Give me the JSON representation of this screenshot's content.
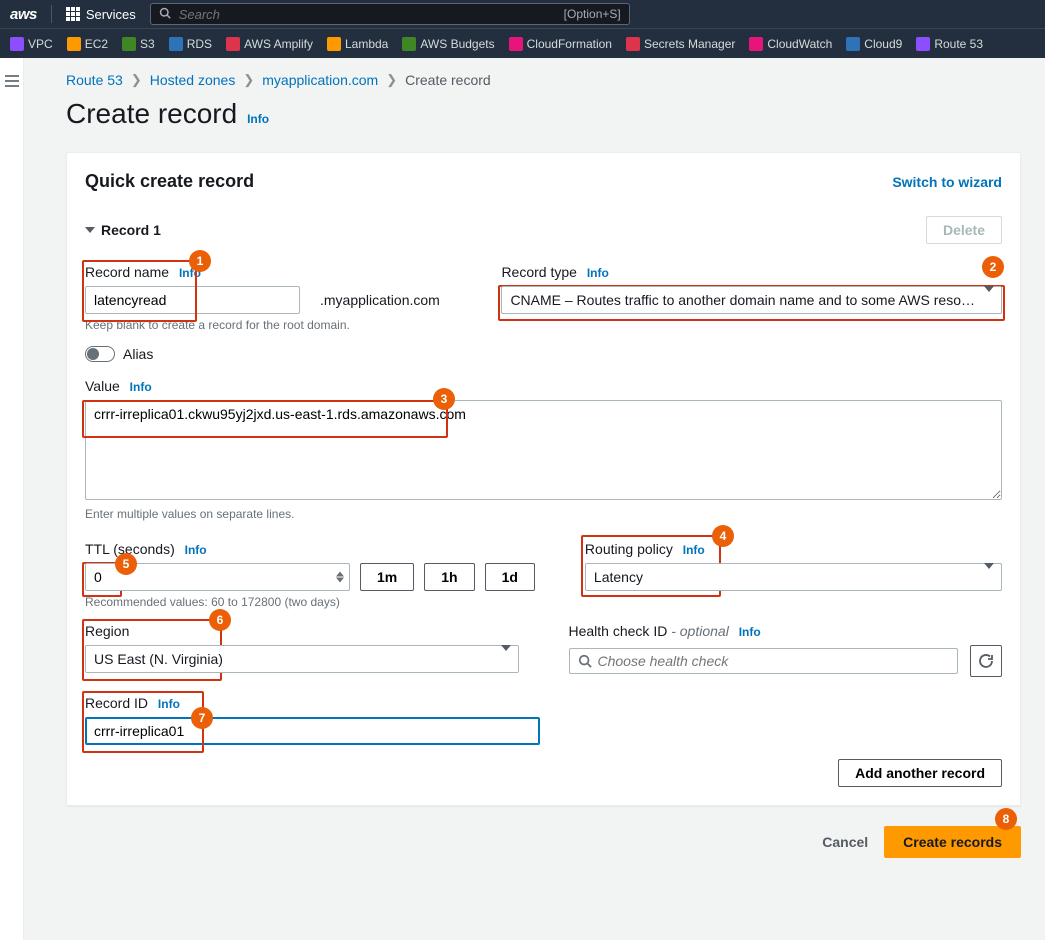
{
  "top": {
    "logo": "aws",
    "services": "Services",
    "search_placeholder": "Search",
    "shortcut": "[Option+S]"
  },
  "svcnav": [
    {
      "label": "VPC",
      "color": "#8c4fff"
    },
    {
      "label": "EC2",
      "color": "#ff9900"
    },
    {
      "label": "S3",
      "color": "#3f8624"
    },
    {
      "label": "RDS",
      "color": "#2e73b8"
    },
    {
      "label": "AWS Amplify",
      "color": "#dd344c"
    },
    {
      "label": "Lambda",
      "color": "#ff9900"
    },
    {
      "label": "AWS Budgets",
      "color": "#3f8624"
    },
    {
      "label": "CloudFormation",
      "color": "#e7157b"
    },
    {
      "label": "Secrets Manager",
      "color": "#dd344c"
    },
    {
      "label": "CloudWatch",
      "color": "#e7157b"
    },
    {
      "label": "Cloud9",
      "color": "#2e73b8"
    },
    {
      "label": "Route 53",
      "color": "#8c4fff"
    }
  ],
  "breadcrumb": {
    "r53": "Route 53",
    "hz": "Hosted zones",
    "domain": "myapplication.com",
    "current": "Create record"
  },
  "page": {
    "title": "Create record",
    "info": "Info"
  },
  "panel": {
    "title": "Quick create record",
    "switch": "Switch to wizard",
    "record_title": "Record 1",
    "delete": "Delete"
  },
  "form": {
    "record_name_label": "Record name",
    "record_name_value": "latencyread",
    "suffix": ".myapplication.com",
    "record_name_hint": "Keep blank to create a record for the root domain.",
    "record_type_label": "Record type",
    "record_type_value": "CNAME – Routes traffic to another domain name and to some AWS reso…",
    "alias_label": "Alias",
    "value_label": "Value",
    "value_text": "crrr-irreplica01.ckwu95yj2jxd.us-east-1.rds.amazonaws.com",
    "value_hint": "Enter multiple values on separate lines.",
    "ttl_label": "TTL (seconds)",
    "ttl_value": "0",
    "ttl_1m": "1m",
    "ttl_1h": "1h",
    "ttl_1d": "1d",
    "ttl_hint": "Recommended values: 60 to 172800 (two days)",
    "routing_label": "Routing policy",
    "routing_value": "Latency",
    "region_label": "Region",
    "region_value": "US East (N. Virginia)",
    "health_label_a": "Health check ID",
    "health_label_b": " - optional",
    "health_placeholder": "Choose health check",
    "record_id_label": "Record ID",
    "record_id_value": "crrr-irreplica01"
  },
  "footer": {
    "add_another": "Add another record",
    "cancel": "Cancel",
    "create": "Create records"
  },
  "badges": {
    "b1": "1",
    "b2": "2",
    "b3": "3",
    "b4": "4",
    "b5": "5",
    "b6": "6",
    "b7": "7",
    "b8": "8"
  }
}
